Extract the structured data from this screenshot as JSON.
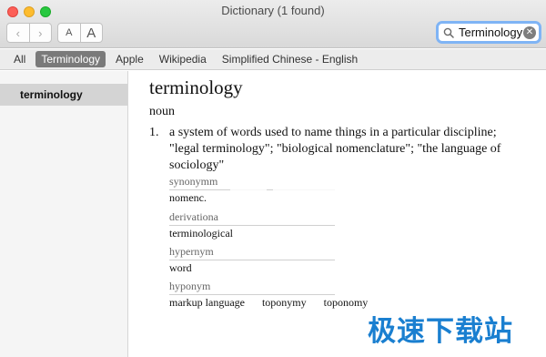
{
  "window": {
    "title": "Dictionary (1 found)"
  },
  "toolbar": {
    "back_glyph": "‹",
    "forward_glyph": "›",
    "font_smaller_label": "A",
    "font_larger_label": "A"
  },
  "search": {
    "value": "Terminology",
    "icon": "search-icon",
    "clear_icon": "clear-icon"
  },
  "scopes": [
    "All",
    "Terminology",
    "Apple",
    "Wikipedia",
    "Simplified Chinese - English"
  ],
  "active_scope": "Terminology",
  "sidebar": {
    "items": [
      "terminology"
    ]
  },
  "entry": {
    "headword": "terminology",
    "part_of_speech": "noun",
    "definitions": [
      {
        "number": "1.",
        "text": "a system of words used to name things in a particular discipline; \"legal terminology\"; \"biological nomenclature\"; \"the language of sociology\""
      }
    ],
    "related": [
      {
        "label": "synonymm",
        "words": [
          "nomenc."
        ]
      },
      {
        "label": "derivationa",
        "words": [
          "terminological"
        ]
      },
      {
        "label": "hypernym",
        "words": [
          "word"
        ]
      },
      {
        "label": "hyponym",
        "words": [
          "markup language",
          "toponymy",
          "toponomy"
        ]
      }
    ]
  },
  "watermark": "极速下载站",
  "colors": {
    "active_scope_bg": "#7a7a7a",
    "search_focus": "#7fb4f5",
    "sidebar_selected": "#d4d4d4"
  }
}
